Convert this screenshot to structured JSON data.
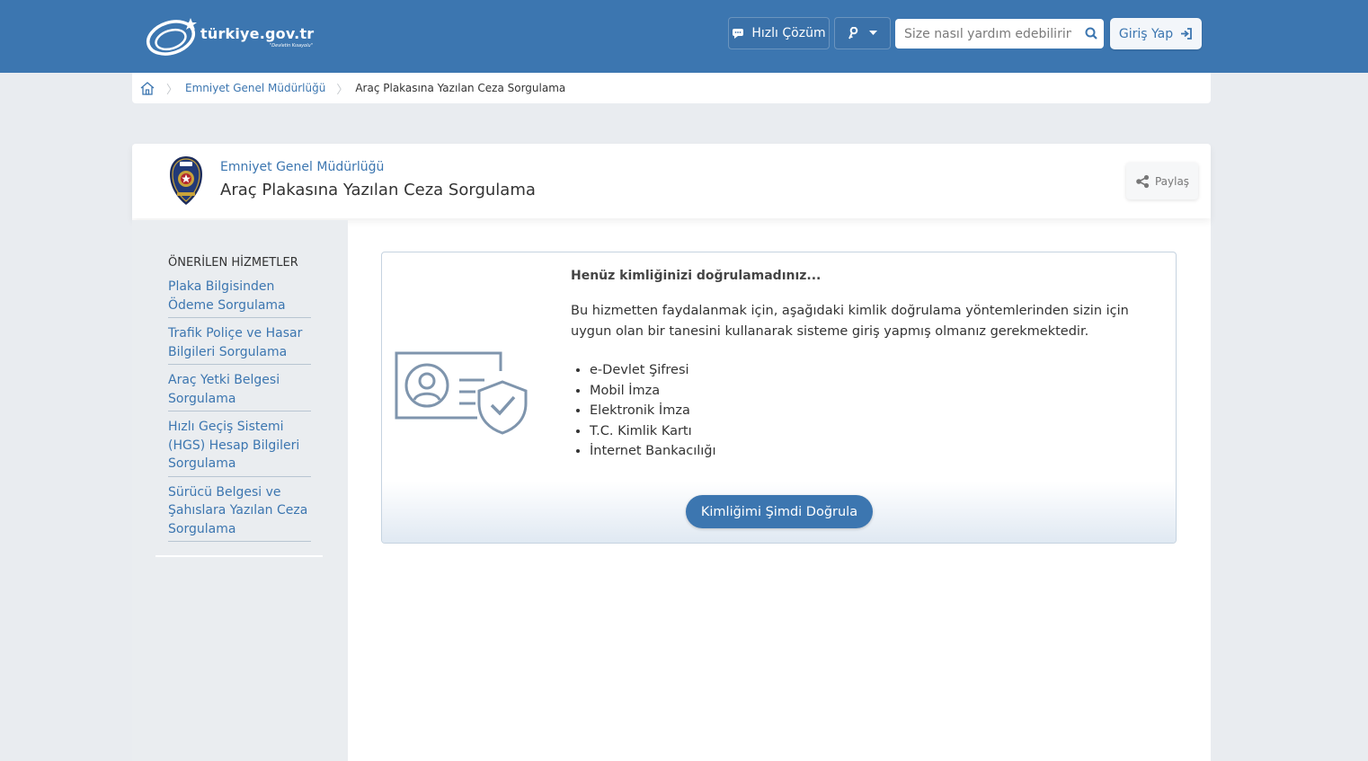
{
  "header": {
    "logo_text": "türkiye.gov.tr",
    "logo_tagline": "\"Devletin Kısayolu\"",
    "quick_solution_label": "Hızlı Çözüm",
    "search_placeholder": "Size nasıl yardım edebilirim?",
    "login_label": "Giriş Yap"
  },
  "breadcrumb": {
    "items": [
      "Emniyet Genel Müdürlüğü",
      "Araç Plakasına Yazılan Ceza Sorgulama"
    ]
  },
  "service": {
    "organization": "Emniyet Genel Müdürlüğü",
    "title": "Araç Plakasına Yazılan Ceza Sorgulama",
    "share_label": "Paylaş"
  },
  "sidebar": {
    "title": "ÖNERİLEN HİZMETLER",
    "items": [
      "Plaka Bilgisinden Ödeme Sorgulama",
      "Trafik Poliçe ve Hasar Bilgileri Sorgulama",
      "Araç Yetki Belgesi Sorgulama",
      "Hızlı Geçiş Sistemi (HGS) Hesap Bilgileri Sorgulama",
      "Sürücü Belgesi ve Şahıslara Yazılan Ceza Sorgulama"
    ]
  },
  "auth": {
    "heading": "Henüz kimliğinizi doğrulamadınız...",
    "description": "Bu hizmetten faydalanmak için, aşağıdaki kimlik doğrulama yöntemlerinden sizin için uygun olan bir tanesini kullanarak sisteme giriş yapmış olmanız gerekmektedir.",
    "methods": [
      "e-Devlet Şifresi",
      "Mobil İmza",
      "Elektronik İmza",
      "T.C. Kimlik Kartı",
      "İnternet Bankacılığı"
    ],
    "verify_button": "Kimliğimi Şimdi Doğrula"
  },
  "colors": {
    "brand_blue": "#3c76b0",
    "page_bg": "#e9ecf0",
    "sidebar_bg": "#eaedf0"
  }
}
